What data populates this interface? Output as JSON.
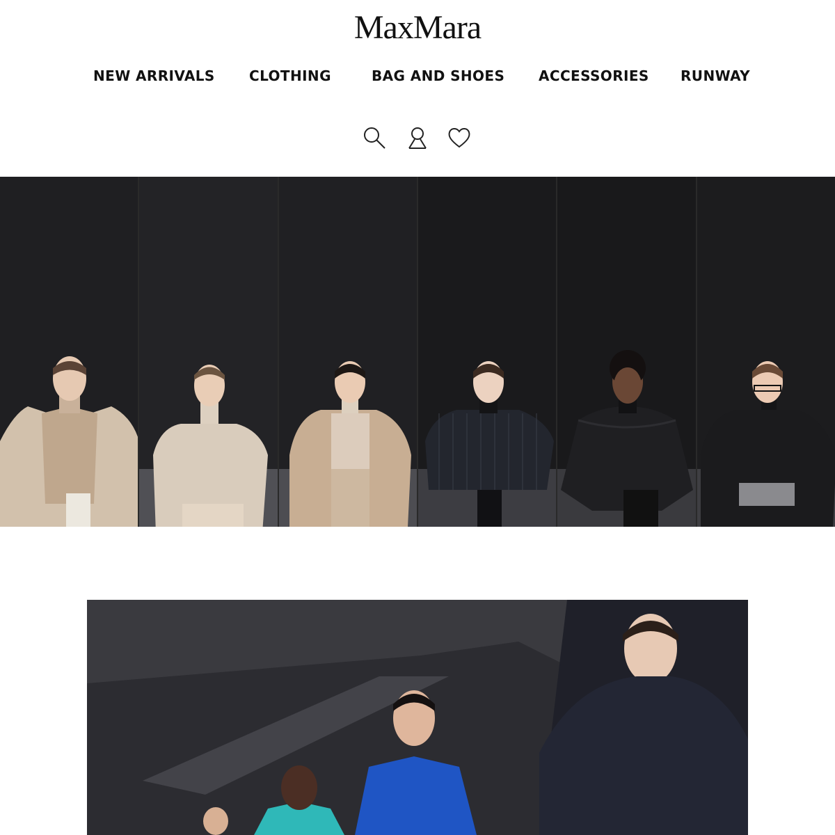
{
  "header": {
    "logo_text": "MaxMara"
  },
  "nav": {
    "items": [
      "NEW ARRIVALS",
      "CLOTHING",
      "BAG AND SHOES",
      "ACCESSORIES",
      "RUNWAY"
    ]
  },
  "utility_icons": [
    "search-icon",
    "account-icon",
    "wishlist-heart-icon"
  ],
  "runway": {
    "looks": [
      {
        "outfit": "teddy coat",
        "tone": "#cdbba6"
      },
      {
        "outfit": "camel knit sweater",
        "tone": "#d7c8b5"
      },
      {
        "outfit": "belted trench",
        "tone": "#c9ae92"
      },
      {
        "outfit": "pinstripe jacket",
        "tone": "#22252d"
      },
      {
        "outfit": "black cape",
        "tone": "#1d1d1f"
      },
      {
        "outfit": "leather coat with bag",
        "tone": "#161617"
      }
    ]
  },
  "campaign": {
    "accent_colors": [
      "#1f55c4",
      "#2fb8b8",
      "#2a2c35"
    ]
  }
}
